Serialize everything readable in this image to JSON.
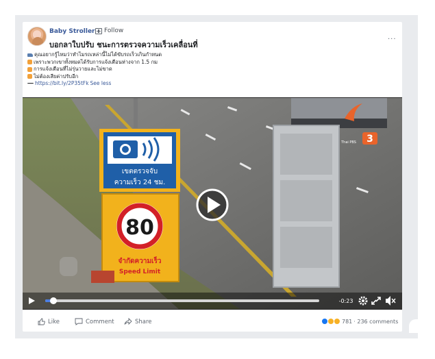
{
  "post": {
    "page_name": "Baby Stroller",
    "separator": "·",
    "follow_label": "Follow",
    "title": "บอกลาใบปรับ ชนะการตรวจความเร็วเคลื่อนที่",
    "more_label": "···",
    "body_lines": [
      "คุณอยากรู้ไหมว่าทำไมรถเหล่านี้ไม่ได้ขับรถเร็วเกินกำหนด",
      "เพราะพวกเขาทั้งหมดได้รับการแจ้งเตือนห่างจาก 1.5 กม",
      "การแจ้งเตือนที่ไม่รุ่นวายและไม่ขาด",
      "ไม่ต้องเสียค่าปรับอีก"
    ],
    "link_text": "https://bit.ly/2P35tFk",
    "see_less": "See less"
  },
  "video": {
    "sign_top_line1": "เขตตรวจจับ",
    "sign_top_line2": "ความเร็ว 24 ชม.",
    "speed_value": "80",
    "sign_bottom_line1": "จำกัดความเร็ว",
    "sign_bottom_line2": "Speed Limit",
    "channel_logo_text": "3",
    "channel_small_text": "Thai PBS",
    "time_remaining": "-0:23",
    "progress_fraction": 0.03
  },
  "actions": {
    "like_label": "Like",
    "comment_label": "Comment",
    "share_label": "Share",
    "reaction_count": "781",
    "comment_count": "· 236 comments"
  },
  "colors": {
    "link": "#385898",
    "sign_blue": "#1f5fa8",
    "sign_yellow": "#f2b21c",
    "ring_red": "#d32027"
  }
}
